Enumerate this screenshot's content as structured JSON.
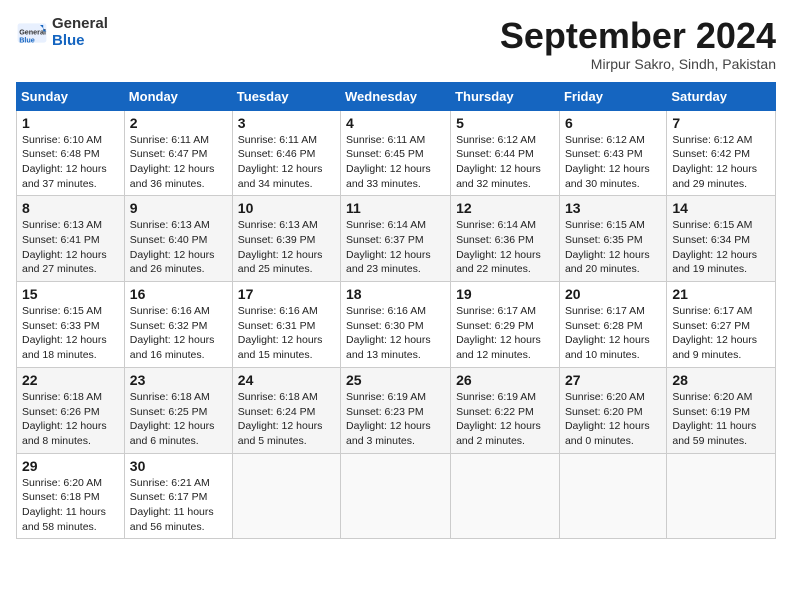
{
  "header": {
    "logo_general": "General",
    "logo_blue": "Blue",
    "month_title": "September 2024",
    "location": "Mirpur Sakro, Sindh, Pakistan"
  },
  "calendar": {
    "days_of_week": [
      "Sunday",
      "Monday",
      "Tuesday",
      "Wednesday",
      "Thursday",
      "Friday",
      "Saturday"
    ],
    "weeks": [
      [
        {
          "day": "1",
          "sunrise": "Sunrise: 6:10 AM",
          "sunset": "Sunset: 6:48 PM",
          "daylight": "Daylight: 12 hours and 37 minutes."
        },
        {
          "day": "2",
          "sunrise": "Sunrise: 6:11 AM",
          "sunset": "Sunset: 6:47 PM",
          "daylight": "Daylight: 12 hours and 36 minutes."
        },
        {
          "day": "3",
          "sunrise": "Sunrise: 6:11 AM",
          "sunset": "Sunset: 6:46 PM",
          "daylight": "Daylight: 12 hours and 34 minutes."
        },
        {
          "day": "4",
          "sunrise": "Sunrise: 6:11 AM",
          "sunset": "Sunset: 6:45 PM",
          "daylight": "Daylight: 12 hours and 33 minutes."
        },
        {
          "day": "5",
          "sunrise": "Sunrise: 6:12 AM",
          "sunset": "Sunset: 6:44 PM",
          "daylight": "Daylight: 12 hours and 32 minutes."
        },
        {
          "day": "6",
          "sunrise": "Sunrise: 6:12 AM",
          "sunset": "Sunset: 6:43 PM",
          "daylight": "Daylight: 12 hours and 30 minutes."
        },
        {
          "day": "7",
          "sunrise": "Sunrise: 6:12 AM",
          "sunset": "Sunset: 6:42 PM",
          "daylight": "Daylight: 12 hours and 29 minutes."
        }
      ],
      [
        {
          "day": "8",
          "sunrise": "Sunrise: 6:13 AM",
          "sunset": "Sunset: 6:41 PM",
          "daylight": "Daylight: 12 hours and 27 minutes."
        },
        {
          "day": "9",
          "sunrise": "Sunrise: 6:13 AM",
          "sunset": "Sunset: 6:40 PM",
          "daylight": "Daylight: 12 hours and 26 minutes."
        },
        {
          "day": "10",
          "sunrise": "Sunrise: 6:13 AM",
          "sunset": "Sunset: 6:39 PM",
          "daylight": "Daylight: 12 hours and 25 minutes."
        },
        {
          "day": "11",
          "sunrise": "Sunrise: 6:14 AM",
          "sunset": "Sunset: 6:37 PM",
          "daylight": "Daylight: 12 hours and 23 minutes."
        },
        {
          "day": "12",
          "sunrise": "Sunrise: 6:14 AM",
          "sunset": "Sunset: 6:36 PM",
          "daylight": "Daylight: 12 hours and 22 minutes."
        },
        {
          "day": "13",
          "sunrise": "Sunrise: 6:15 AM",
          "sunset": "Sunset: 6:35 PM",
          "daylight": "Daylight: 12 hours and 20 minutes."
        },
        {
          "day": "14",
          "sunrise": "Sunrise: 6:15 AM",
          "sunset": "Sunset: 6:34 PM",
          "daylight": "Daylight: 12 hours and 19 minutes."
        }
      ],
      [
        {
          "day": "15",
          "sunrise": "Sunrise: 6:15 AM",
          "sunset": "Sunset: 6:33 PM",
          "daylight": "Daylight: 12 hours and 18 minutes."
        },
        {
          "day": "16",
          "sunrise": "Sunrise: 6:16 AM",
          "sunset": "Sunset: 6:32 PM",
          "daylight": "Daylight: 12 hours and 16 minutes."
        },
        {
          "day": "17",
          "sunrise": "Sunrise: 6:16 AM",
          "sunset": "Sunset: 6:31 PM",
          "daylight": "Daylight: 12 hours and 15 minutes."
        },
        {
          "day": "18",
          "sunrise": "Sunrise: 6:16 AM",
          "sunset": "Sunset: 6:30 PM",
          "daylight": "Daylight: 12 hours and 13 minutes."
        },
        {
          "day": "19",
          "sunrise": "Sunrise: 6:17 AM",
          "sunset": "Sunset: 6:29 PM",
          "daylight": "Daylight: 12 hours and 12 minutes."
        },
        {
          "day": "20",
          "sunrise": "Sunrise: 6:17 AM",
          "sunset": "Sunset: 6:28 PM",
          "daylight": "Daylight: 12 hours and 10 minutes."
        },
        {
          "day": "21",
          "sunrise": "Sunrise: 6:17 AM",
          "sunset": "Sunset: 6:27 PM",
          "daylight": "Daylight: 12 hours and 9 minutes."
        }
      ],
      [
        {
          "day": "22",
          "sunrise": "Sunrise: 6:18 AM",
          "sunset": "Sunset: 6:26 PM",
          "daylight": "Daylight: 12 hours and 8 minutes."
        },
        {
          "day": "23",
          "sunrise": "Sunrise: 6:18 AM",
          "sunset": "Sunset: 6:25 PM",
          "daylight": "Daylight: 12 hours and 6 minutes."
        },
        {
          "day": "24",
          "sunrise": "Sunrise: 6:18 AM",
          "sunset": "Sunset: 6:24 PM",
          "daylight": "Daylight: 12 hours and 5 minutes."
        },
        {
          "day": "25",
          "sunrise": "Sunrise: 6:19 AM",
          "sunset": "Sunset: 6:23 PM",
          "daylight": "Daylight: 12 hours and 3 minutes."
        },
        {
          "day": "26",
          "sunrise": "Sunrise: 6:19 AM",
          "sunset": "Sunset: 6:22 PM",
          "daylight": "Daylight: 12 hours and 2 minutes."
        },
        {
          "day": "27",
          "sunrise": "Sunrise: 6:20 AM",
          "sunset": "Sunset: 6:20 PM",
          "daylight": "Daylight: 12 hours and 0 minutes."
        },
        {
          "day": "28",
          "sunrise": "Sunrise: 6:20 AM",
          "sunset": "Sunset: 6:19 PM",
          "daylight": "Daylight: 11 hours and 59 minutes."
        }
      ],
      [
        {
          "day": "29",
          "sunrise": "Sunrise: 6:20 AM",
          "sunset": "Sunset: 6:18 PM",
          "daylight": "Daylight: 11 hours and 58 minutes."
        },
        {
          "day": "30",
          "sunrise": "Sunrise: 6:21 AM",
          "sunset": "Sunset: 6:17 PM",
          "daylight": "Daylight: 11 hours and 56 minutes."
        },
        null,
        null,
        null,
        null,
        null
      ]
    ]
  }
}
